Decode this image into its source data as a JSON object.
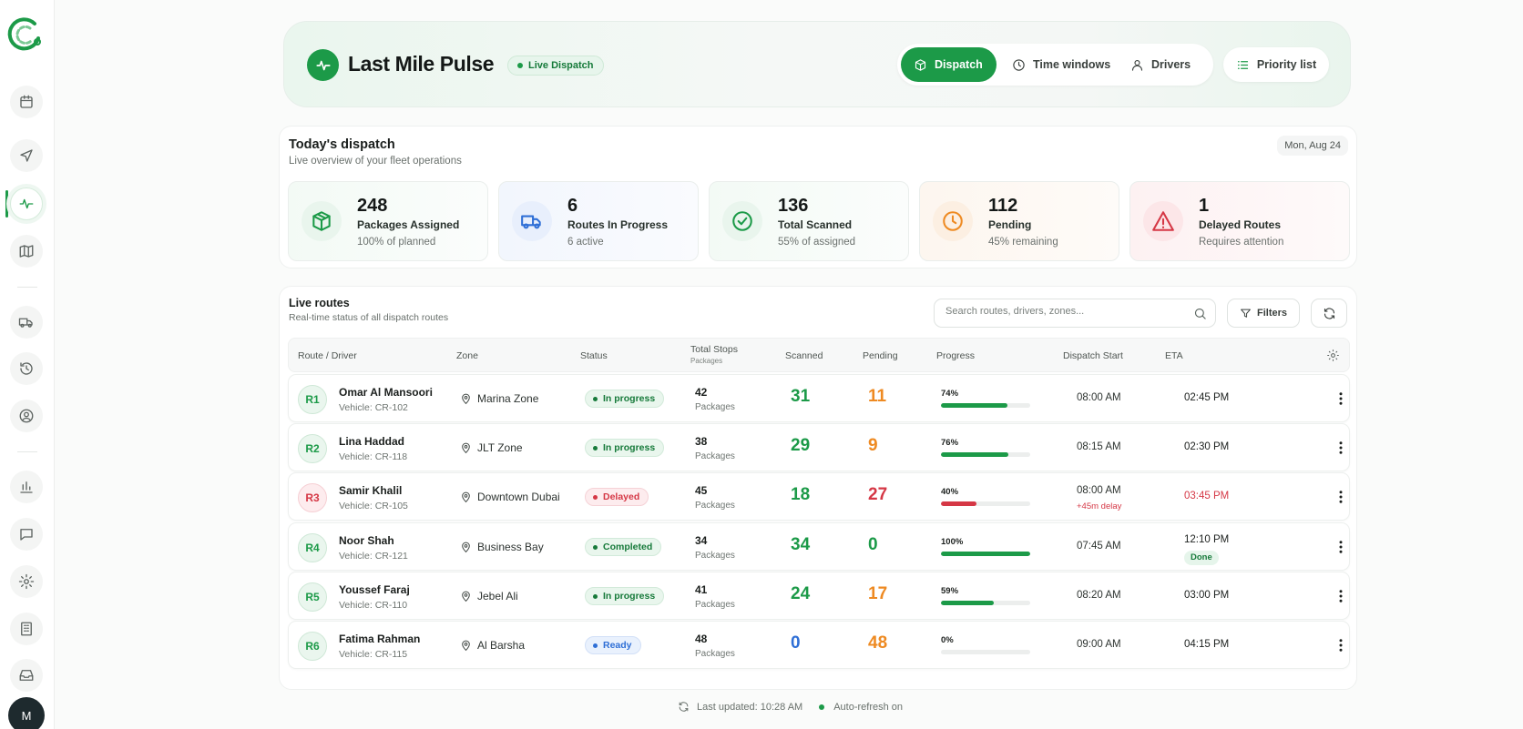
{
  "app": {
    "title": "Last Mile Pulse",
    "live_label": "Live Dispatch",
    "avatar_initial": "M"
  },
  "header": {
    "tabs": [
      {
        "label": "Dispatch",
        "icon": "box-icon",
        "active": true
      },
      {
        "label": "Time windows",
        "icon": "clock-icon",
        "active": false
      },
      {
        "label": "Drivers",
        "icon": "user-icon",
        "active": false
      }
    ],
    "priority_label": "Priority list"
  },
  "sidebar": {
    "items": [
      "calendar-icon",
      "navigation-icon",
      "pulse-icon",
      "map-icon",
      "truck-icon",
      "history-icon",
      "user-circle-icon",
      "bar-chart-icon",
      "chat-icon",
      "settings-icon",
      "building-icon",
      "inbox-icon"
    ],
    "active": "pulse-icon"
  },
  "dispatch": {
    "title": "Today's dispatch",
    "subtitle": "Live overview of your fleet operations",
    "date": "Mon, Aug 24",
    "stats": [
      {
        "value": "248",
        "label": "Packages Assigned",
        "sub": "100% of planned",
        "icon": "package-icon",
        "color": "#1c9a48"
      },
      {
        "value": "6",
        "label": "Routes In Progress",
        "sub": "6 active",
        "icon": "truck-icon",
        "color": "#2f6fd6"
      },
      {
        "value": "136",
        "label": "Total Scanned",
        "sub": "55% of assigned",
        "icon": "check-circle-icon",
        "color": "#1c9a48"
      },
      {
        "value": "112",
        "label": "Pending",
        "sub": "45% remaining",
        "icon": "clock-icon",
        "color": "#ee8a22"
      },
      {
        "value": "1",
        "label": "Delayed Routes",
        "sub": "Requires attention",
        "icon": "alert-triangle-icon",
        "color": "#d53745"
      }
    ]
  },
  "routes": {
    "title": "Live routes",
    "subtitle": "Real-time status of all dispatch routes",
    "search_placeholder": "Search routes, drivers, zones...",
    "filters_label": "Filters",
    "columns": {
      "route": "Route / Driver",
      "zone": "Zone",
      "status": "Status",
      "stops": "Total Stops",
      "stops_sub": "Packages",
      "scanned": "Scanned",
      "pending": "Pending",
      "progress": "Progress",
      "dispatch": "Dispatch Start",
      "eta": "ETA"
    },
    "rows": [
      {
        "id": "R1",
        "driver": "Omar Al Mansoori",
        "vehicle": "Vehicle: CR-102",
        "zone": "Marina Zone",
        "status": "In progress",
        "status_kind": "progress",
        "stops": "42",
        "stops_unit": "Packages",
        "scanned": "31",
        "pending": "11",
        "progress": 74,
        "progress_label": "74%",
        "dispatch": "08:00 AM",
        "eta": "02:45 PM"
      },
      {
        "id": "R2",
        "driver": "Lina Haddad",
        "vehicle": "Vehicle: CR-118",
        "zone": "JLT Zone",
        "status": "In progress",
        "status_kind": "progress",
        "stops": "38",
        "stops_unit": "Packages",
        "scanned": "29",
        "pending": "9",
        "progress": 76,
        "progress_label": "76%",
        "dispatch": "08:15 AM",
        "eta": "02:30 PM"
      },
      {
        "id": "R3",
        "driver": "Samir Khalil",
        "vehicle": "Vehicle: CR-105",
        "zone": "Downtown Dubai",
        "status": "Delayed",
        "status_kind": "delayed",
        "stops": "45",
        "stops_unit": "Packages",
        "scanned": "18",
        "pending": "27",
        "progress": 40,
        "progress_label": "40%",
        "dispatch": "08:00 AM",
        "delay_note": "+45m delay",
        "eta": "03:45 PM"
      },
      {
        "id": "R4",
        "driver": "Noor Shah",
        "vehicle": "Vehicle: CR-121",
        "zone": "Business Bay",
        "status": "Completed",
        "status_kind": "completed",
        "stops": "34",
        "stops_unit": "Packages",
        "scanned": "34",
        "pending": "0",
        "progress": 100,
        "progress_label": "100%",
        "dispatch": "07:45 AM",
        "eta": "12:10 PM",
        "eta_badge": "Done"
      },
      {
        "id": "R5",
        "driver": "Youssef Faraj",
        "vehicle": "Vehicle: CR-110",
        "zone": "Jebel Ali",
        "status": "In progress",
        "status_kind": "progress",
        "stops": "41",
        "stops_unit": "Packages",
        "scanned": "24",
        "pending": "17",
        "progress": 59,
        "progress_label": "59%",
        "dispatch": "08:20 AM",
        "eta": "03:00 PM"
      },
      {
        "id": "R6",
        "driver": "Fatima Rahman",
        "vehicle": "Vehicle: CR-115",
        "zone": "Al Barsha",
        "status": "Ready",
        "status_kind": "ready",
        "stops": "48",
        "stops_unit": "Packages",
        "scanned": "0",
        "pending": "48",
        "progress": 0,
        "progress_label": "0%",
        "dispatch": "09:00 AM",
        "eta": "04:15 PM"
      }
    ]
  },
  "footer": {
    "last_updated": "Last updated: 10:28 AM",
    "auto_refresh": "Auto-refresh on"
  },
  "colors": {
    "accent": "#1c9a48",
    "warning": "#ee8a22",
    "danger": "#d53745",
    "info": "#2f6fd6"
  }
}
